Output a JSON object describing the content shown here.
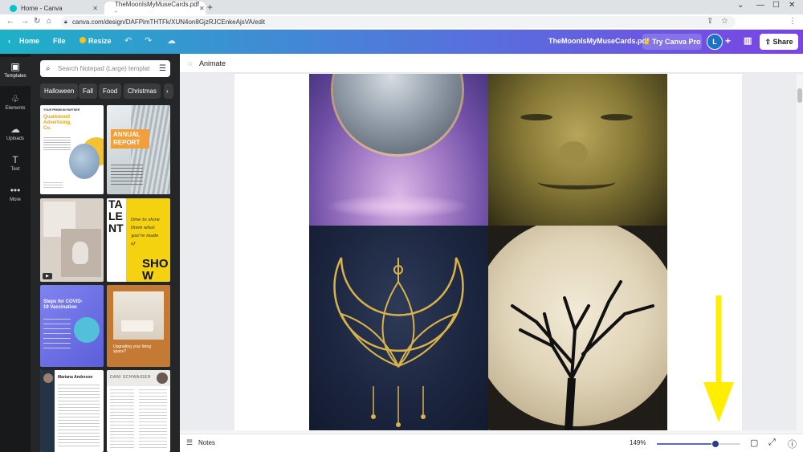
{
  "browser": {
    "tabs": [
      {
        "title": "Home - Canva",
        "active": false
      },
      {
        "title": "TheMoonIsMyMuseCards.pdf - ",
        "active": true
      }
    ],
    "url": "canva.com/design/DAFPimTHTFk/XUN4on8GjzRJCEnkeAjsVA/edit"
  },
  "toolbar": {
    "home": "Home",
    "file": "File",
    "resize": "Resize",
    "doc_title": "TheMoonIsMyMuseCards.pdf",
    "try_pro": "Try Canva Pro",
    "avatar_initial": "L",
    "share": "Share"
  },
  "rail": {
    "items": [
      {
        "label": "Templates",
        "icon": "templates-icon",
        "active": true
      },
      {
        "label": "Elements",
        "icon": "elements-icon",
        "active": false
      },
      {
        "label": "Uploads",
        "icon": "uploads-icon",
        "active": false
      },
      {
        "label": "Text",
        "icon": "text-icon",
        "active": false
      },
      {
        "label": "More",
        "icon": "more-icon",
        "active": false
      }
    ]
  },
  "panel": {
    "search_placeholder": "Search Notepad (Large) templat",
    "chips": [
      "Halloween",
      "Fall",
      "Food",
      "Christmas"
    ],
    "templates": {
      "t1_kicker": "YOUR PREMIUM PARTNER",
      "t1_title": "Quarkwood Advertising, Co.",
      "t2_title": "ANNUAL REPORT",
      "t4_big": "TALENT",
      "t4_line": "time to show them what you're made of",
      "t4_show": "SHOW",
      "t5_title": "Steps for COVID-19 Vaccination",
      "t6_line": "Upgrading your living space?",
      "t7_name": "Mariana Anderson",
      "t8_name": "DANI SCHWAIGER"
    }
  },
  "editor": {
    "animate": "Animate",
    "notes": "Notes",
    "zoom_label": "149%",
    "zoom_fraction": 0.7
  },
  "colors": {
    "accent_arrow": "#ffee00",
    "toolbar_start": "#1db1c7",
    "toolbar_end": "#7b43e6"
  }
}
